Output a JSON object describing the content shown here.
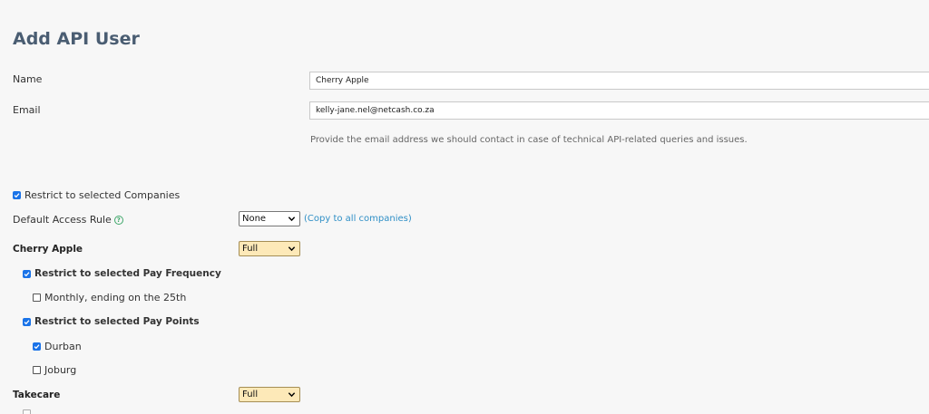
{
  "page": {
    "title": "Add API User"
  },
  "form": {
    "name_label": "Name",
    "name_value": "Cherry Apple",
    "email_label": "Email",
    "email_value": "kelly-jane.nel@netcash.co.za",
    "email_help": "Provide the email address we should contact in case of technical API-related queries and issues."
  },
  "restrict_companies": {
    "label": "Restrict to selected Companies",
    "checked": true
  },
  "default_access": {
    "label": "Default Access Rule",
    "help_icon": "question-circle-icon",
    "selected": "None",
    "copy_link": "(Copy to all companies)"
  },
  "companies": [
    {
      "name": "Cherry Apple",
      "access": "Full",
      "restrict_pay_frequency_label": "Restrict to selected Pay Frequency",
      "pay_frequencies": [
        {
          "label": "Monthly, ending on the 25th",
          "checked": false
        }
      ],
      "restrict_pay_points_label": "Restrict to selected Pay Points",
      "pay_points": [
        {
          "label": "Durban",
          "checked": true
        },
        {
          "label": "Joburg",
          "checked": false
        }
      ]
    },
    {
      "name": "Takecare",
      "access": "Full"
    }
  ],
  "colors": {
    "title": "#4a5d72",
    "checkbox": "#1a73e8",
    "link": "#2f8fc6",
    "full_select_bg": "#fde9b8",
    "help_icon": "#3fa76a"
  }
}
